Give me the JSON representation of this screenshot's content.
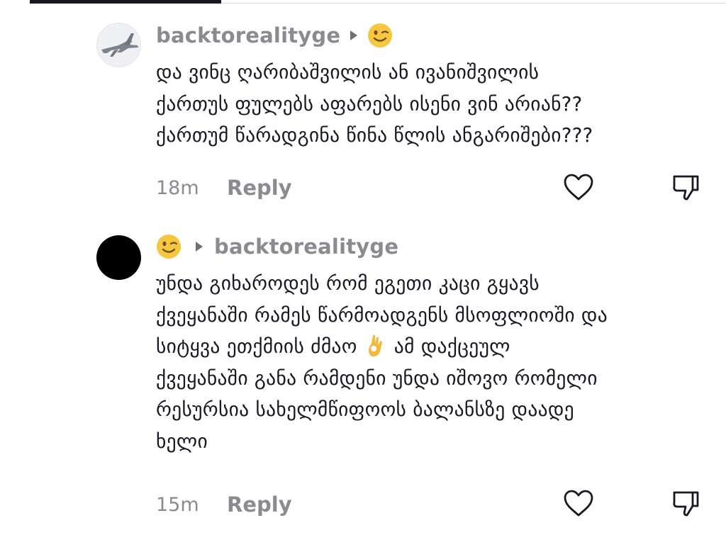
{
  "comments": [
    {
      "username": "backtorealityge",
      "lines": [
        "და ვინც ღარიბაშვილის ან ივანიშვილის",
        "ქართუს ფულებს აფარებს ისენი ვინ არიან??",
        "ქართუმ წარადგინა წინა წლის ანგარიშები???"
      ],
      "time": "18m",
      "reply_label": "Reply"
    },
    {
      "reply_to": "backtorealityge",
      "lines": [
        "უნდა გიხაროდეს რომ ეგეთი კაცი გყავს",
        "ქვეყანაში რამეს წარმოადგენს მსოფლიოში და",
        "სიტყვა ეთქმიის ძმაო",
        "ამ დაქცეულ",
        "ქვეყანაში განა რამდენი უნდა იშოვო რომელი",
        "რესურსია სახელმწიფოოს ბალანსზე დაადე",
        "ხელი"
      ],
      "time": "15m",
      "reply_label": "Reply"
    }
  ],
  "icons": {
    "wink": "winking-face-emoji",
    "ok_hand": "ok-hand-emoji",
    "arrow": "right-triangle",
    "like": "heart-outline",
    "dislike": "thumbs-down-outline"
  },
  "colors": {
    "primary_text": "#161823",
    "secondary_text": "#8a8b91",
    "emoji_yellow": "#f6c63f"
  }
}
